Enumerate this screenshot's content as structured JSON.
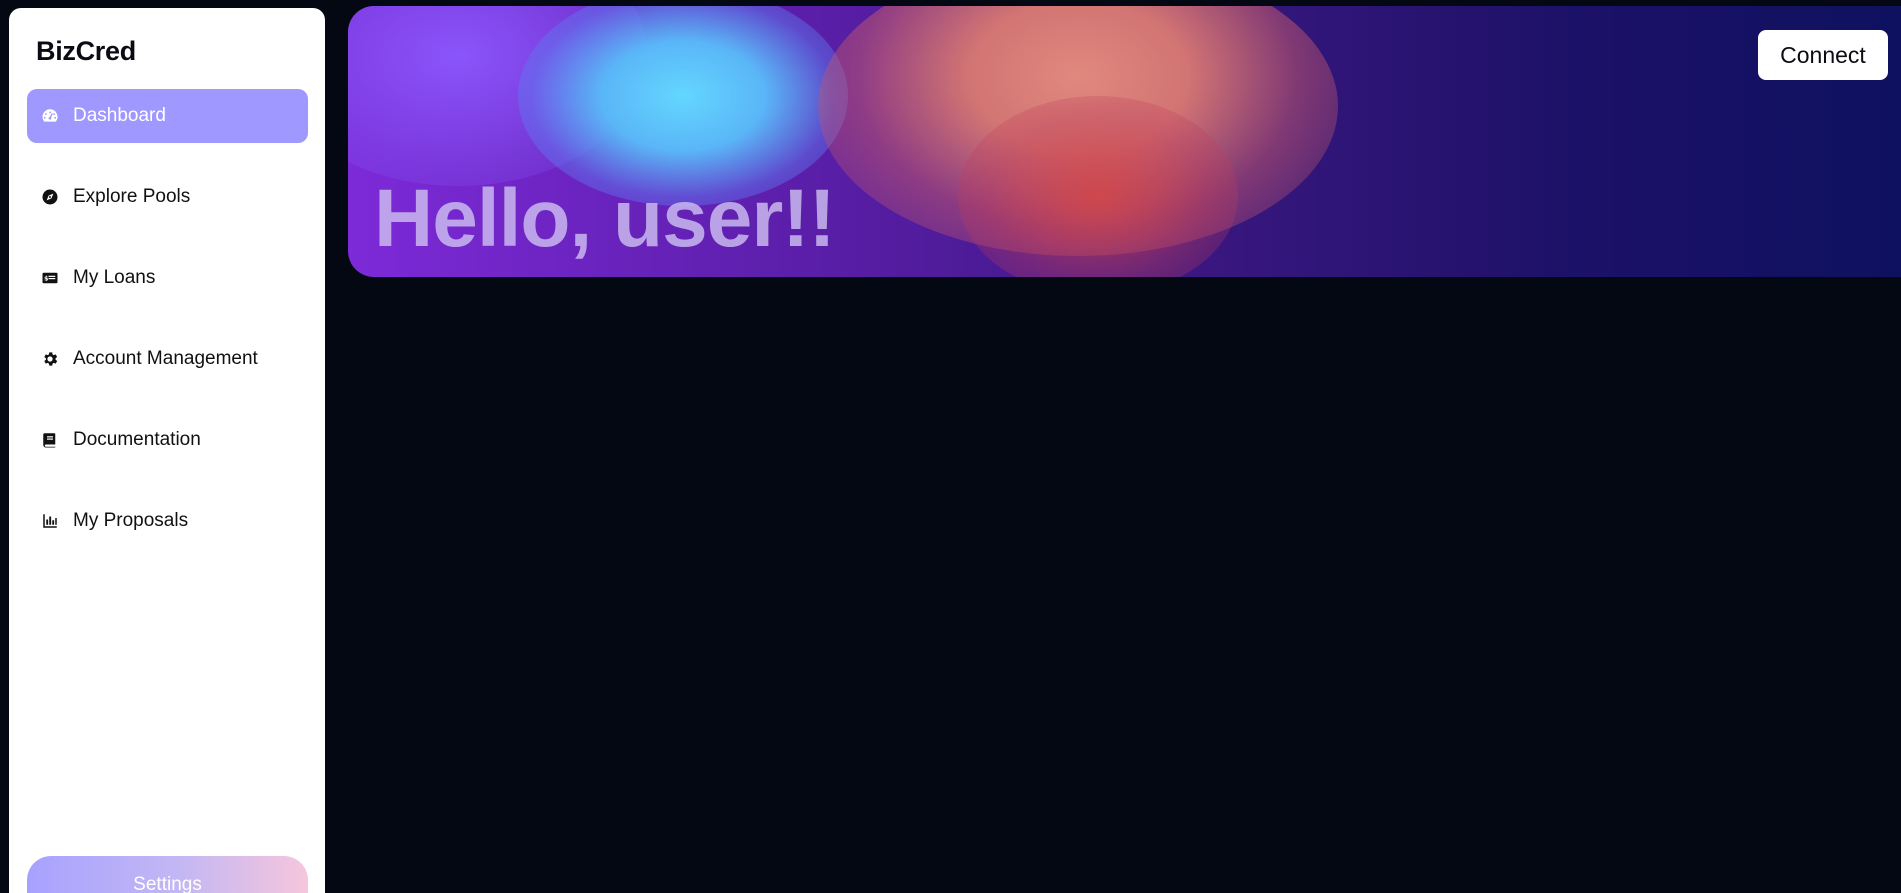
{
  "app": {
    "brand": "BizCred"
  },
  "sidebar": {
    "items": [
      {
        "label": "Dashboard",
        "icon": "speedometer-icon",
        "active": true
      },
      {
        "label": "Explore Pools",
        "icon": "compass-icon",
        "active": false
      },
      {
        "label": "My Loans",
        "icon": "money-card-icon",
        "active": false
      },
      {
        "label": "Account Management",
        "icon": "gear-icon",
        "active": false
      },
      {
        "label": "Documentation",
        "icon": "book-icon",
        "active": false
      },
      {
        "label": "My Proposals",
        "icon": "bar-chart-icon",
        "active": false
      }
    ],
    "settings_label": "Settings"
  },
  "hero": {
    "greeting": "Hello, user!!"
  },
  "header": {
    "connect_label": "Connect"
  },
  "colors": {
    "background": "#040812",
    "sidebar_bg": "#ffffff",
    "active_item": "#9f98ff",
    "settings_gradient_start": "#a7a2ff",
    "settings_gradient_end": "#f6c6dc"
  }
}
